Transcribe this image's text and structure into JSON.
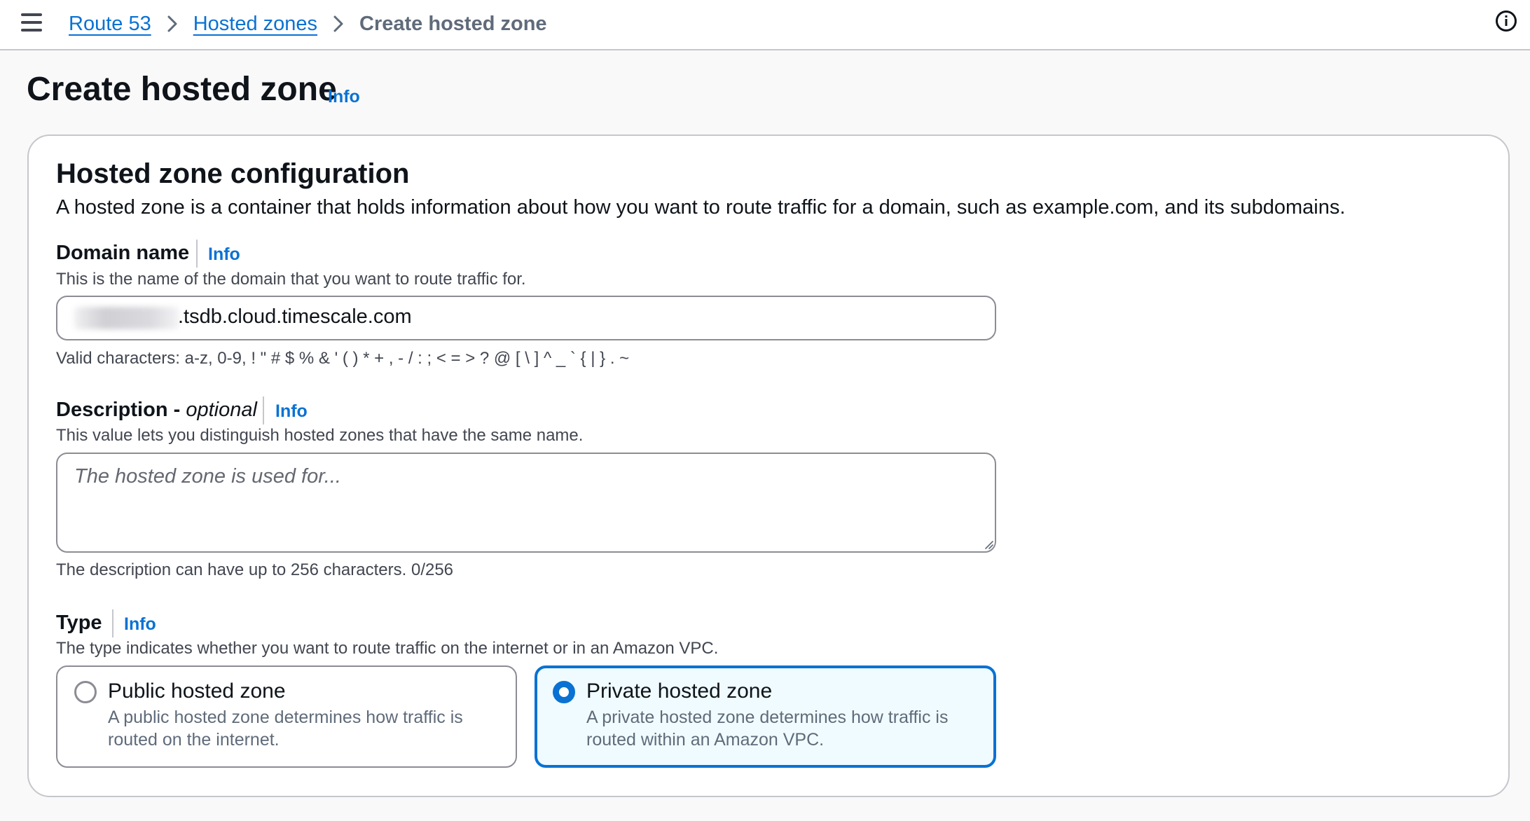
{
  "breadcrumb": {
    "items": [
      {
        "label": "Route 53"
      },
      {
        "label": "Hosted zones"
      },
      {
        "label": "Create hosted zone"
      }
    ]
  },
  "page": {
    "title": "Create hosted zone",
    "info_label": "Info"
  },
  "section": {
    "title": "Hosted zone configuration",
    "description": "A hosted zone is a container that holds information about how you want to route traffic for a domain, such as example.com, and its subdomains."
  },
  "domain_name": {
    "label": "Domain name",
    "info_label": "Info",
    "description": "This is the name of the domain that you want to route traffic for.",
    "value": ".tsdb.cloud.timescale.com",
    "constraint": "Valid characters: a-z, 0-9, ! \" # $ % & ' ( ) * + , - / : ; < = > ? @ [ \\ ] ^ _ ` { | } . ~"
  },
  "description_field": {
    "label": "Description - ",
    "label_optional": "optional",
    "info_label": "Info",
    "description": "This value lets you distinguish hosted zones that have the same name.",
    "placeholder": "The hosted zone is used for...",
    "constraint": "The description can have up to 256 characters. 0/256"
  },
  "type_field": {
    "label": "Type",
    "info_label": "Info",
    "description": "The type indicates whether you want to route traffic on the internet or in an Amazon VPC.",
    "options": [
      {
        "title": "Public hosted zone",
        "description": "A public hosted zone determines how traffic is routed on the internet.",
        "selected": false
      },
      {
        "title": "Private hosted zone",
        "description": "A private hosted zone determines how traffic is routed within an Amazon VPC.",
        "selected": true
      }
    ]
  },
  "icons": {
    "menu": "hamburger-menu-icon",
    "separator": "chevron-right-icon",
    "help": "info-circle-icon"
  },
  "colors": {
    "link": "#0972d3",
    "selected_border": "#0972d3",
    "selected_background": "#f0fbff",
    "text": "#0f141a",
    "muted_text": "#5f6b7a"
  }
}
